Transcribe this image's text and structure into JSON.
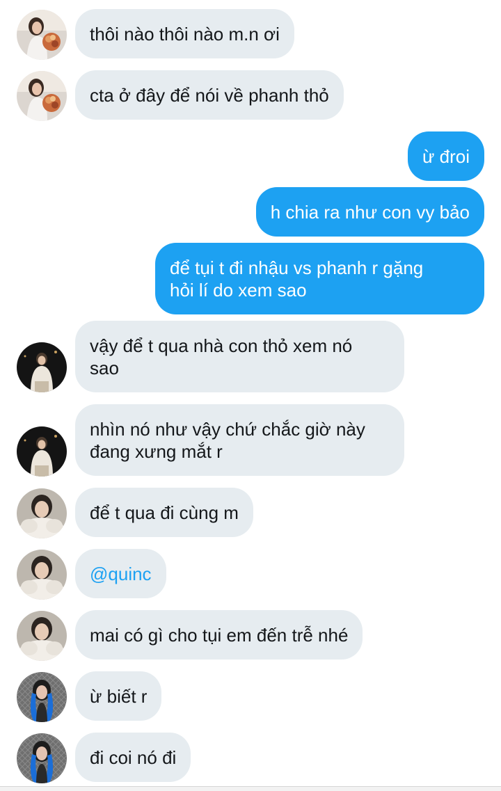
{
  "colors": {
    "incoming_bubble": "#e6ecf0",
    "outgoing_bubble": "#1da1f2",
    "mention": "#1da1f2",
    "text": "#14171a"
  },
  "messages": [
    {
      "sender": "incoming",
      "avatar": "avatar-woman-flowers",
      "text": "thôi nào thôi nào m.n ơi"
    },
    {
      "sender": "incoming",
      "avatar": "avatar-woman-flowers",
      "text": "cta ở đây để nói về phanh thỏ"
    },
    {
      "sender": "outgoing",
      "text": "ừ đroi"
    },
    {
      "sender": "outgoing",
      "text": "h chia ra như con vy bảo"
    },
    {
      "sender": "outgoing",
      "text": "để tụi t đi nhậu vs phanh r gặng\nhỏi lí do xem sao"
    },
    {
      "sender": "incoming",
      "avatar": "avatar-woman-night",
      "text": "vậy để t qua nhà con thỏ xem nó\nsao"
    },
    {
      "sender": "incoming",
      "avatar": "avatar-woman-night",
      "text": "nhìn nó như vậy chứ chắc giờ này\nđang xưng mắt r"
    },
    {
      "sender": "incoming",
      "avatar": "avatar-woman-fur",
      "text": "để t qua đi cùng m"
    },
    {
      "sender": "incoming",
      "avatar": "avatar-woman-fur",
      "text": "@quinc"
    },
    {
      "sender": "incoming",
      "avatar": "avatar-woman-fur",
      "text": "mai có gì cho tụi em đến trễ nhé"
    },
    {
      "sender": "incoming",
      "avatar": "avatar-woman-blue-hair",
      "text": "ừ biết r"
    },
    {
      "sender": "incoming",
      "avatar": "avatar-woman-blue-hair",
      "text": "đi coi nó đi"
    }
  ]
}
